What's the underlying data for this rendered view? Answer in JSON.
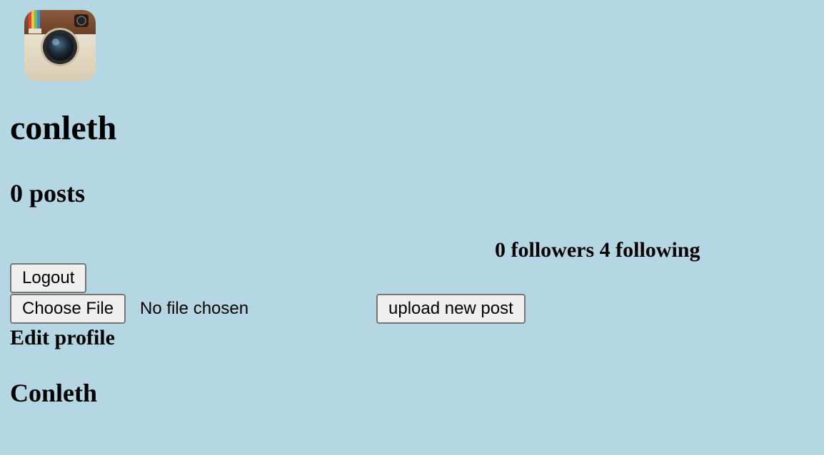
{
  "profile": {
    "username": "conleth",
    "posts_label": "0 posts",
    "follow_stats": "0 followers 4 following",
    "display_name": "Conleth",
    "logo_icon": "instagram-camera-logo-icon"
  },
  "actions": {
    "logout_label": "Logout",
    "choose_file_label": "Choose File",
    "no_file_text": "No file chosen",
    "upload_label": "upload new post",
    "edit_profile_label": "Edit profile"
  },
  "colors": {
    "background": "#b5d7e4"
  }
}
